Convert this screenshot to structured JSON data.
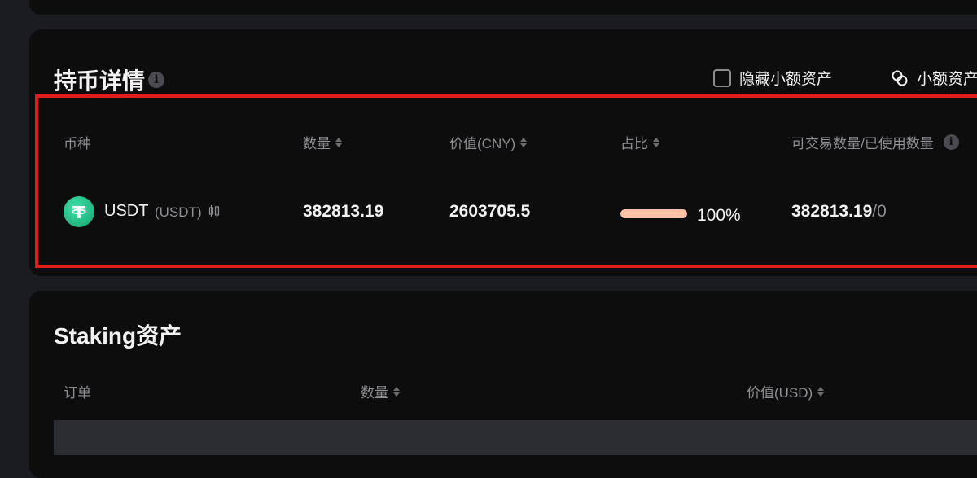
{
  "holdings": {
    "title": "持币详情",
    "info_icon": "i",
    "hide_small_label": "隐藏小额资产",
    "small_assets_label": "小额资产",
    "columns": {
      "coin": "币种",
      "quantity": "数量",
      "value": "价值(CNY)",
      "ratio": "占比",
      "available": "可交易数量/已使用数量"
    },
    "rows": [
      {
        "coin_name": "USDT",
        "coin_symbol": "(USDT)",
        "quantity": "382813.19",
        "value": "2603705.5",
        "ratio_fraction": 1.0,
        "ratio_text": "100%",
        "available": "382813.19",
        "available_sep": "/",
        "used": "0"
      }
    ]
  },
  "staking": {
    "title": "Staking资产",
    "columns": {
      "order": "订单",
      "quantity": "数量",
      "value": "价值(USD)"
    }
  },
  "colors": {
    "highlight": "#e01c1c",
    "ratio_bar": "#ffc0a8",
    "coin_green": "#26b882"
  },
  "icons": {
    "info": "info-icon",
    "sort": "sort-arrows-icon",
    "convert": "convert-icon",
    "coin": "usdt-coin-icon",
    "kline": "candlestick-icon"
  }
}
